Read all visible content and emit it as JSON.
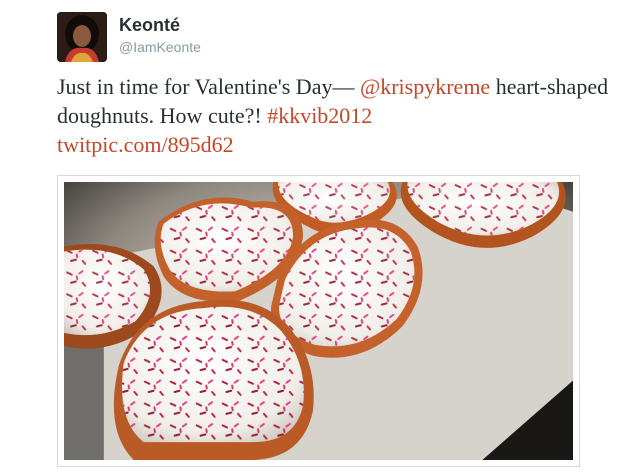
{
  "tweet": {
    "author_name": "Keonté",
    "author_handle": "@IamKeonte",
    "text_start": "Just in time for Valentine's Day— ",
    "mention": "@krispykreme",
    "text_middle": " heart-shaped doughnuts. How cute?! ",
    "hashtag": "#kkvib2012",
    "link": "twitpic.com/895d62"
  },
  "colors": {
    "link": "#c4472a",
    "text": "#292f33",
    "handle": "#8899a6",
    "icing": "#f4f2f0",
    "dough": "#c5612a",
    "sprinkle_red": "#a3162e",
    "sprinkle_pink": "#e2357a"
  },
  "icons": {
    "avatar": "profile-photo",
    "photo": "heart-shaped-doughnuts-photo"
  }
}
